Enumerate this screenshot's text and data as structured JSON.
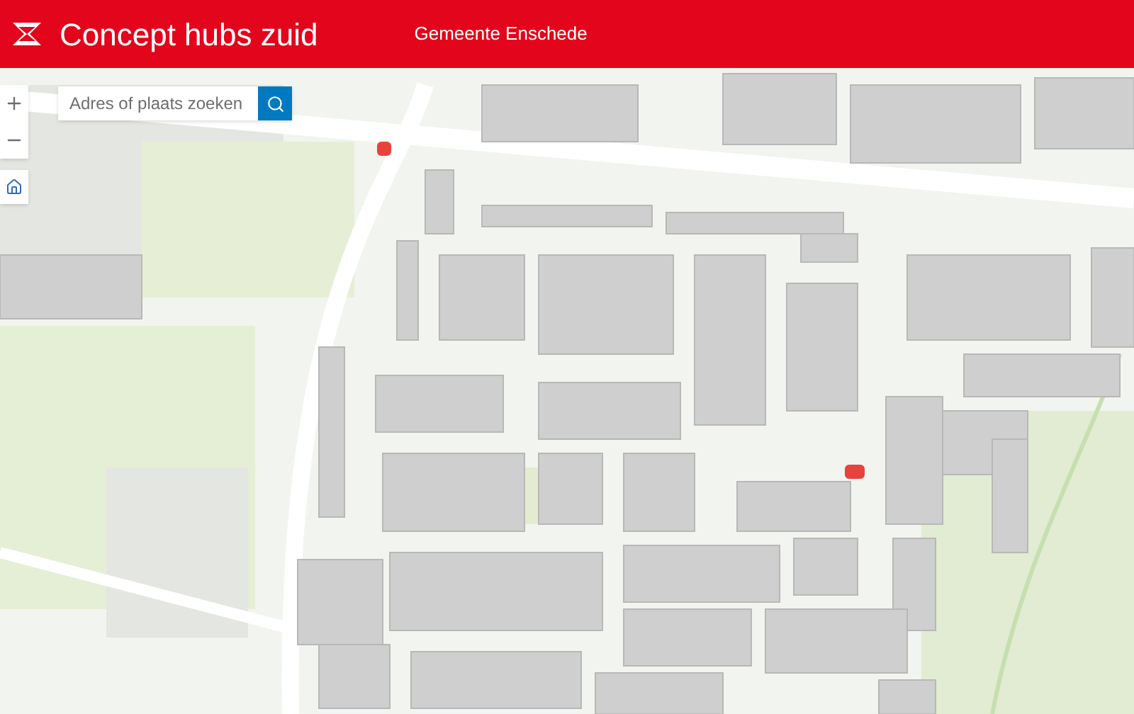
{
  "header": {
    "title": "Concept hubs zuid",
    "organization": "Gemeente Enschede"
  },
  "search": {
    "placeholder": "Adres of plaats zoeken"
  }
}
